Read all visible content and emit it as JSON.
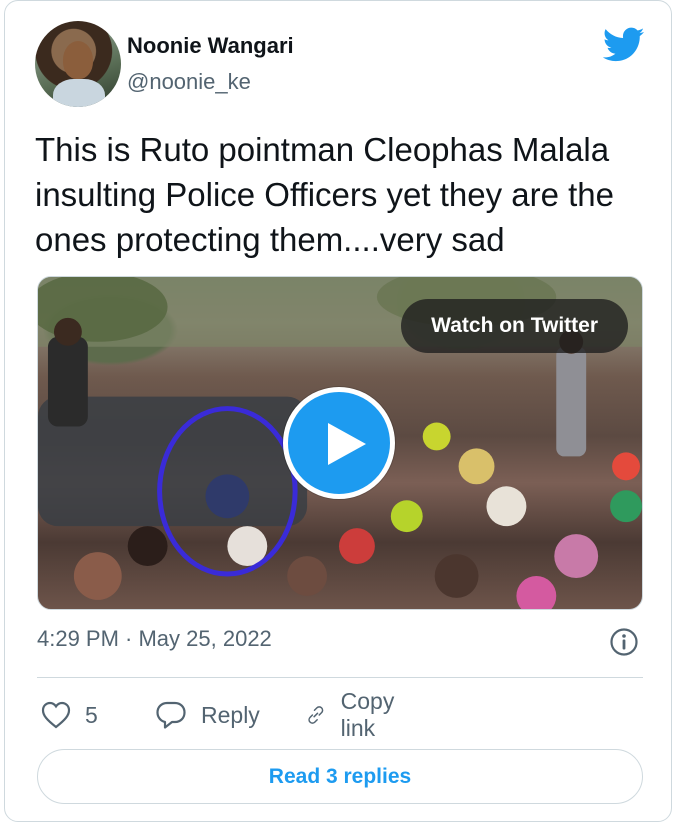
{
  "tweet": {
    "author_name": "Noonie Wangari",
    "author_handle": "@noonie_ke",
    "text": "This is Ruto pointman Cleophas Malala insulting Police Officers yet they are the ones protecting them....very sad",
    "timestamp": "4:29 PM · May 25, 2022"
  },
  "media": {
    "watch_label": "Watch on Twitter"
  },
  "actions": {
    "like_count": "5",
    "reply_label": "Reply",
    "copy_link_label": "Copy link"
  },
  "footer": {
    "read_replies_label": "Read 3 replies"
  },
  "colors": {
    "accent": "#1d9bf0",
    "secondary_text": "#536471",
    "border": "#cfd9de"
  },
  "icons": {
    "logo": "twitter-bird-icon",
    "play": "play-icon",
    "info": "info-icon",
    "like": "heart-icon",
    "reply": "comment-icon",
    "copy": "link-icon"
  }
}
